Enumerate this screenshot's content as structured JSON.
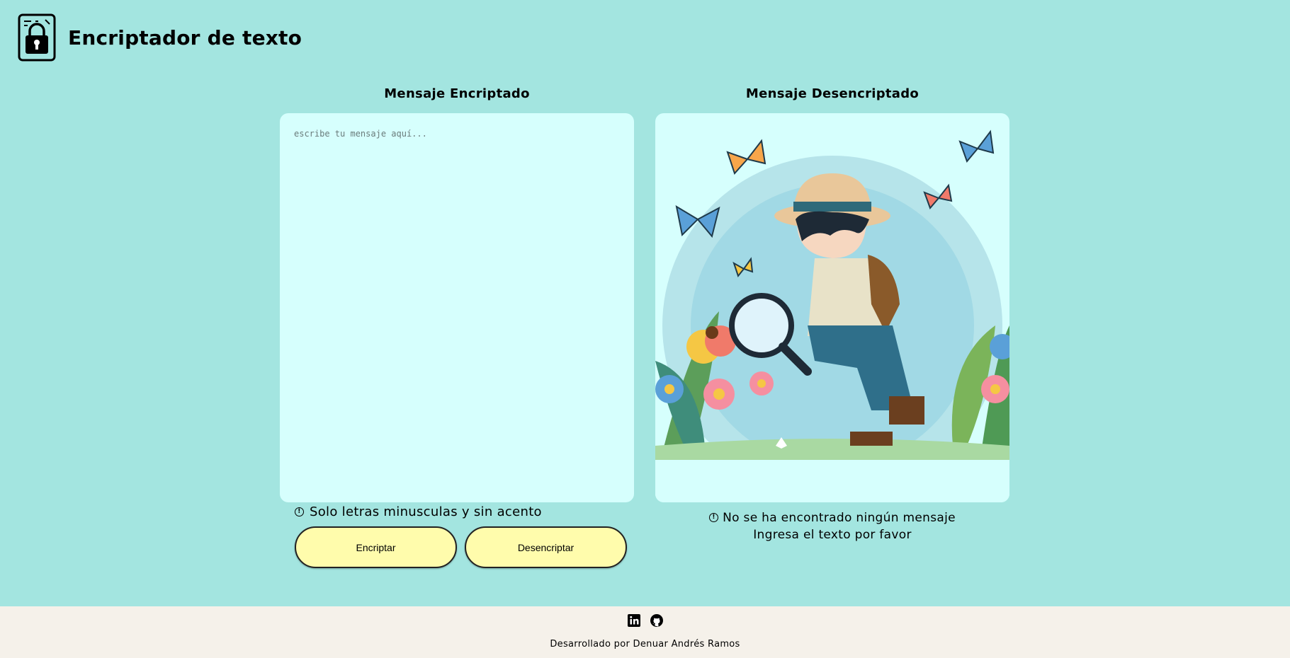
{
  "header": {
    "title": "Encriptador de texto",
    "logo_icon": "lock-document-icon"
  },
  "left_panel": {
    "title": "Mensaje Encriptado",
    "input_value": "",
    "input_placeholder": "escribe tu mensaje aquí...",
    "hint": "Solo letras minusculas y sin acento"
  },
  "right_panel": {
    "title": "Mensaje Desencriptado",
    "illustration": "boy-with-magnifying-glass-illustration",
    "message_line1": "No se ha encontrado ningún mensaje",
    "message_line2": "Ingresa el texto por favor"
  },
  "buttons": {
    "encrypt_label": "Encriptar",
    "decrypt_label": "Desencriptar"
  },
  "footer": {
    "icons": [
      "linkedin-icon",
      "github-icon"
    ],
    "credits": "Desarrollado por Denuar Andrés Ramos"
  },
  "colors": {
    "background": "#a3e5e0",
    "panel": "#d6fffd",
    "button": "#fffcac",
    "footer": "#f5f1ea"
  }
}
